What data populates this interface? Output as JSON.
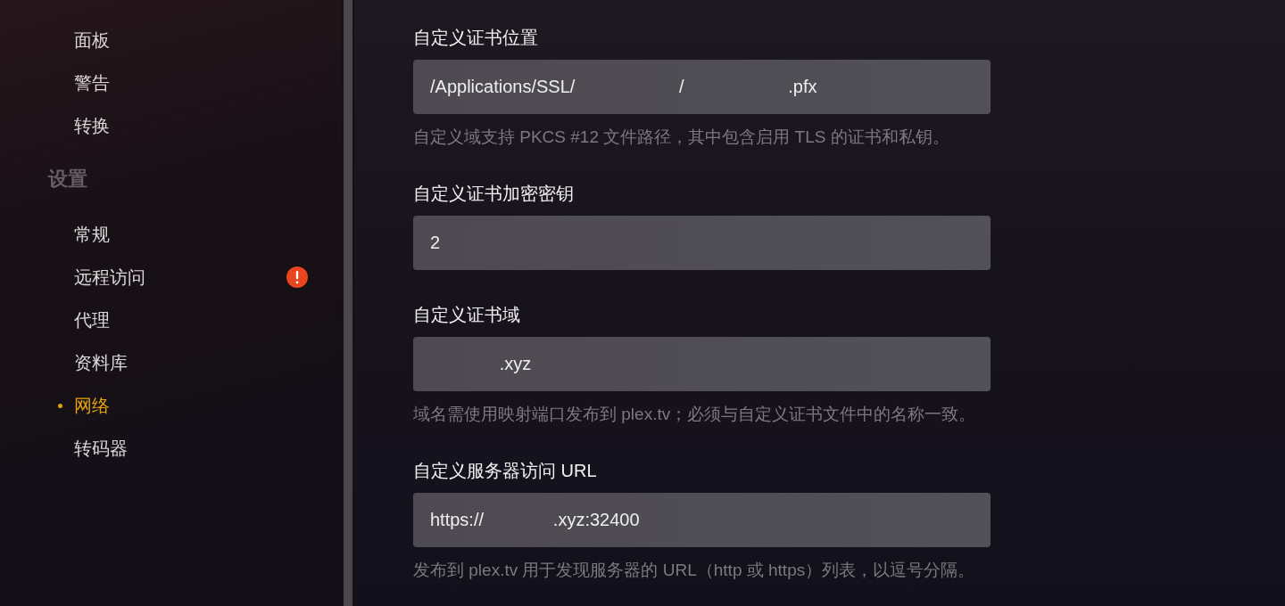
{
  "sidebar": {
    "groups": [
      {
        "items": [
          {
            "label": "面板",
            "selected": false,
            "warning": false
          },
          {
            "label": "警告",
            "selected": false,
            "warning": false
          },
          {
            "label": "转换",
            "selected": false,
            "warning": false
          }
        ]
      },
      {
        "heading": "设置",
        "items": [
          {
            "label": "常规",
            "selected": false,
            "warning": false
          },
          {
            "label": "远程访问",
            "selected": false,
            "warning": true
          },
          {
            "label": "代理",
            "selected": false,
            "warning": false
          },
          {
            "label": "资料库",
            "selected": false,
            "warning": false
          },
          {
            "label": "网络",
            "selected": true,
            "warning": false
          },
          {
            "label": "转码器",
            "selected": false,
            "warning": false
          }
        ]
      }
    ]
  },
  "settings": [
    {
      "label": "自定义证书位置",
      "value": "/Applications/SSL/                     /                     .pfx",
      "help": "自定义域支持 PKCS #12 文件路径，其中包含启用 TLS 的证书和私钥。"
    },
    {
      "label": "自定义证书加密密钥",
      "value": "2"
    },
    {
      "label": "自定义证书域",
      "value": "              .xyz",
      "help": "域名需使用映射端口发布到 plex.tv；必须与自定义证书文件中的名称一致。"
    },
    {
      "label": "自定义服务器访问 URL",
      "value": "https://              .xyz:32400",
      "help": "发布到 plex.tv 用于发现服务器的 URL（http 或 https）列表，以逗号分隔。"
    }
  ]
}
